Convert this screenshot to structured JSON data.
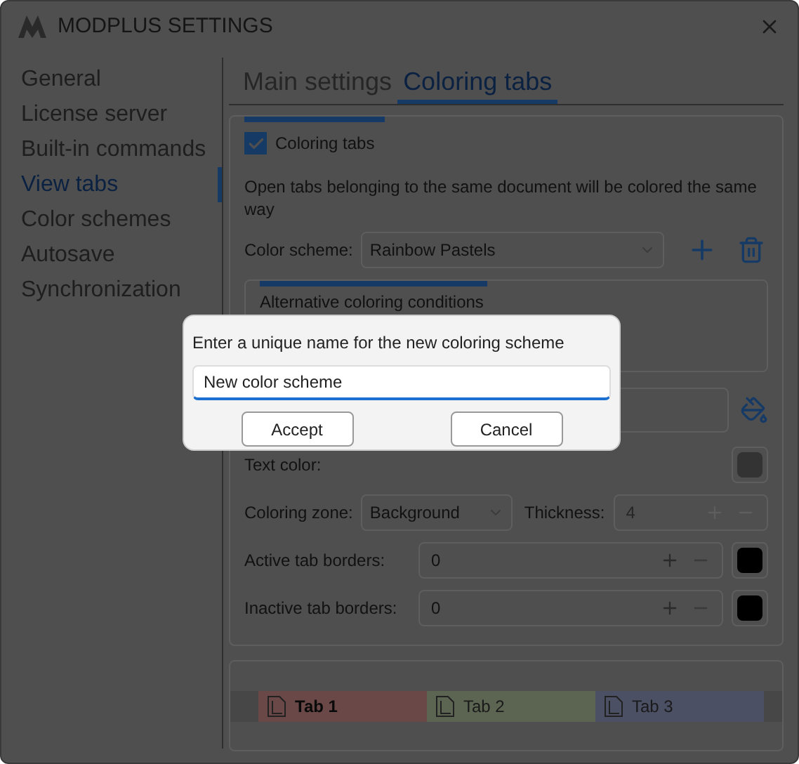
{
  "window": {
    "title": "MODPLUS SETTINGS"
  },
  "sidebar": {
    "items": [
      {
        "label": "General",
        "selected": false
      },
      {
        "label": "License server",
        "selected": false
      },
      {
        "label": "Built-in commands",
        "selected": false
      },
      {
        "label": "View tabs",
        "selected": true
      },
      {
        "label": "Color schemes",
        "selected": false
      },
      {
        "label": "Autosave",
        "selected": false
      },
      {
        "label": "Synchronization",
        "selected": false
      }
    ]
  },
  "tabs": [
    {
      "label": "Main settings",
      "selected": false
    },
    {
      "label": "Coloring tabs",
      "selected": true
    }
  ],
  "coloring": {
    "enable": {
      "label": "Coloring tabs",
      "checked": true
    },
    "description": "Open tabs belonging to the same document will be colored the same way",
    "color_scheme": {
      "label": "Color scheme:",
      "value": "Rainbow Pastels"
    },
    "alternative": {
      "title": "Alternative coloring conditions"
    },
    "text_color": {
      "label": "Text color:",
      "color": "#333333"
    },
    "coloring_zone": {
      "label": "Coloring zone:",
      "value": "Background"
    },
    "thickness": {
      "label": "Thickness:",
      "value": "4",
      "disabled": true
    },
    "active_borders": {
      "label": "Active tab borders:",
      "value": "0",
      "color": "#000000"
    },
    "inactive_borders": {
      "label": "Inactive tab borders:",
      "value": "0",
      "color": "#000000"
    }
  },
  "preview": {
    "tabs": [
      {
        "label": "Tab 1",
        "selected": true,
        "color": "#6a4848"
      },
      {
        "label": "Tab 2",
        "selected": false,
        "color": "#5c6452"
      },
      {
        "label": "Tab 3",
        "selected": false,
        "color": "#4c5064"
      }
    ]
  },
  "dialog": {
    "prompt": "Enter a unique name for the new coloring scheme",
    "value": "New color scheme",
    "buttons": [
      "Accept",
      "Cancel"
    ]
  }
}
